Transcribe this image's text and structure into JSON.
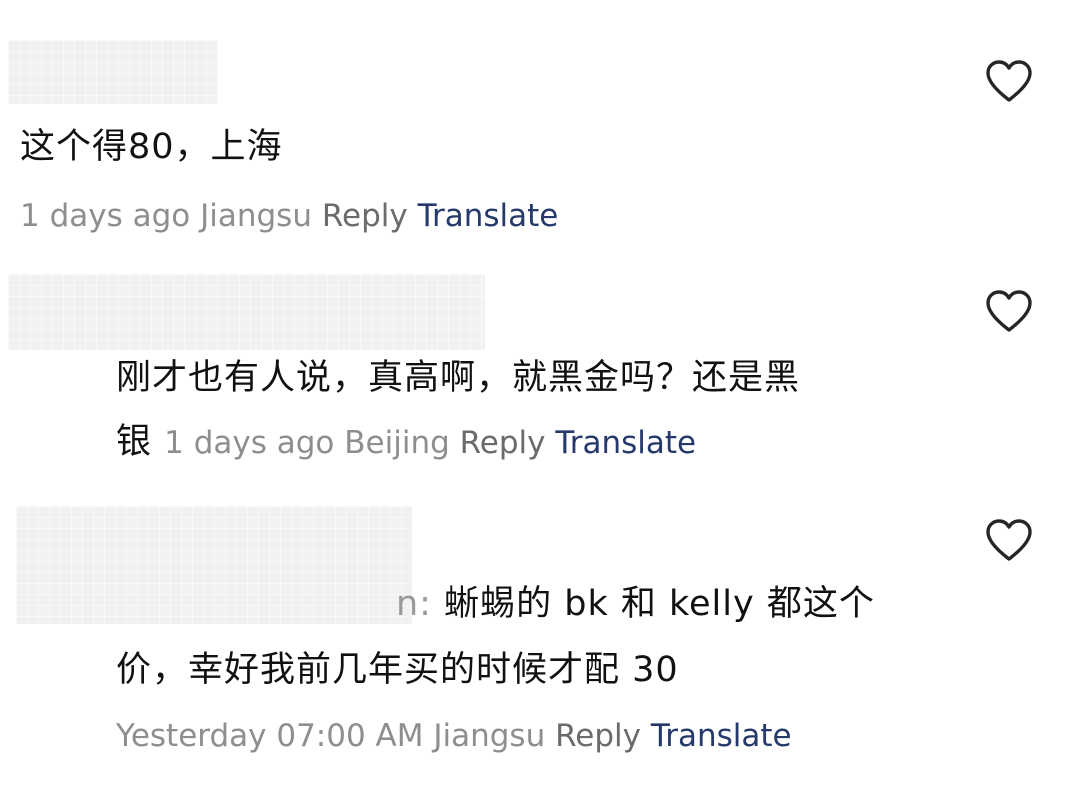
{
  "comments": [
    {
      "text": "这个得80，上海",
      "time": "1 days ago",
      "location": "Jiangsu",
      "reply_label": "Reply",
      "translate_label": "Translate"
    },
    {
      "text_line1": "刚才也有人说，真高啊，就黑金吗？还是黑",
      "text_line2": "银",
      "time": "1 days ago",
      "location": "Beijing",
      "reply_label": "Reply",
      "translate_label": "Translate"
    },
    {
      "mention_tail": "n:",
      "text_line1": "蜥蜴的 bk 和 kelly 都这个",
      "text_line2": "价，幸好我前几年买的时候才配 30",
      "time": "Yesterday 07:00 AM",
      "location": "Jiangsu",
      "reply_label": "Reply",
      "translate_label": "Translate"
    }
  ],
  "icons": {
    "like": "heart-outline-icon"
  }
}
